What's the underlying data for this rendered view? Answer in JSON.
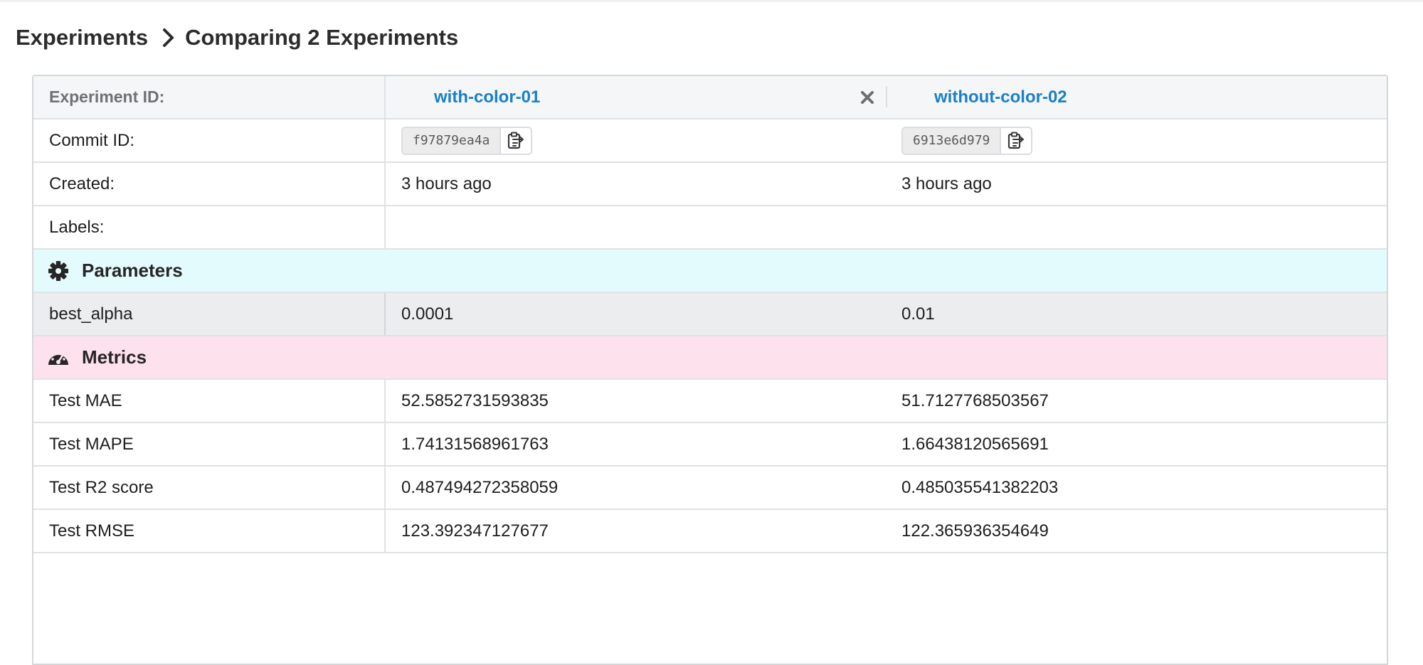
{
  "breadcrumb": {
    "root": "Experiments",
    "current": "Comparing 2 Experiments"
  },
  "header": {
    "label": "Experiment ID:",
    "experiments": [
      "with-color-01",
      "without-color-02"
    ]
  },
  "info_rows": {
    "commit": {
      "label": "Commit ID:",
      "values": [
        "f97879ea4a",
        "6913e6d979"
      ]
    },
    "created": {
      "label": "Created:",
      "values": [
        "3 hours ago",
        "3 hours ago"
      ]
    },
    "labels": {
      "label": "Labels:",
      "values": [
        "",
        ""
      ]
    }
  },
  "parameters": {
    "title": "Parameters",
    "icon": "gear-icon",
    "rows": [
      {
        "label": "best_alpha",
        "values": [
          "0.0001",
          "0.01"
        ]
      }
    ]
  },
  "metrics": {
    "title": "Metrics",
    "icon": "dashboard-icon",
    "rows": [
      {
        "label": "Test MAE",
        "values": [
          "52.5852731593835",
          "51.7127768503567"
        ]
      },
      {
        "label": "Test MAPE",
        "values": [
          "1.74131568961763",
          "1.66438120565691"
        ]
      },
      {
        "label": "Test R2 score",
        "values": [
          "0.487494272358059",
          "0.485035541382203"
        ]
      },
      {
        "label": "Test RMSE",
        "values": [
          "123.392347127677",
          "122.365936354649"
        ]
      }
    ]
  },
  "colors": {
    "link": "#1a80c6",
    "parameters_bg": "#e4fbfd",
    "metrics_bg": "#fde2ee",
    "header_bg": "#f4f6f7"
  }
}
